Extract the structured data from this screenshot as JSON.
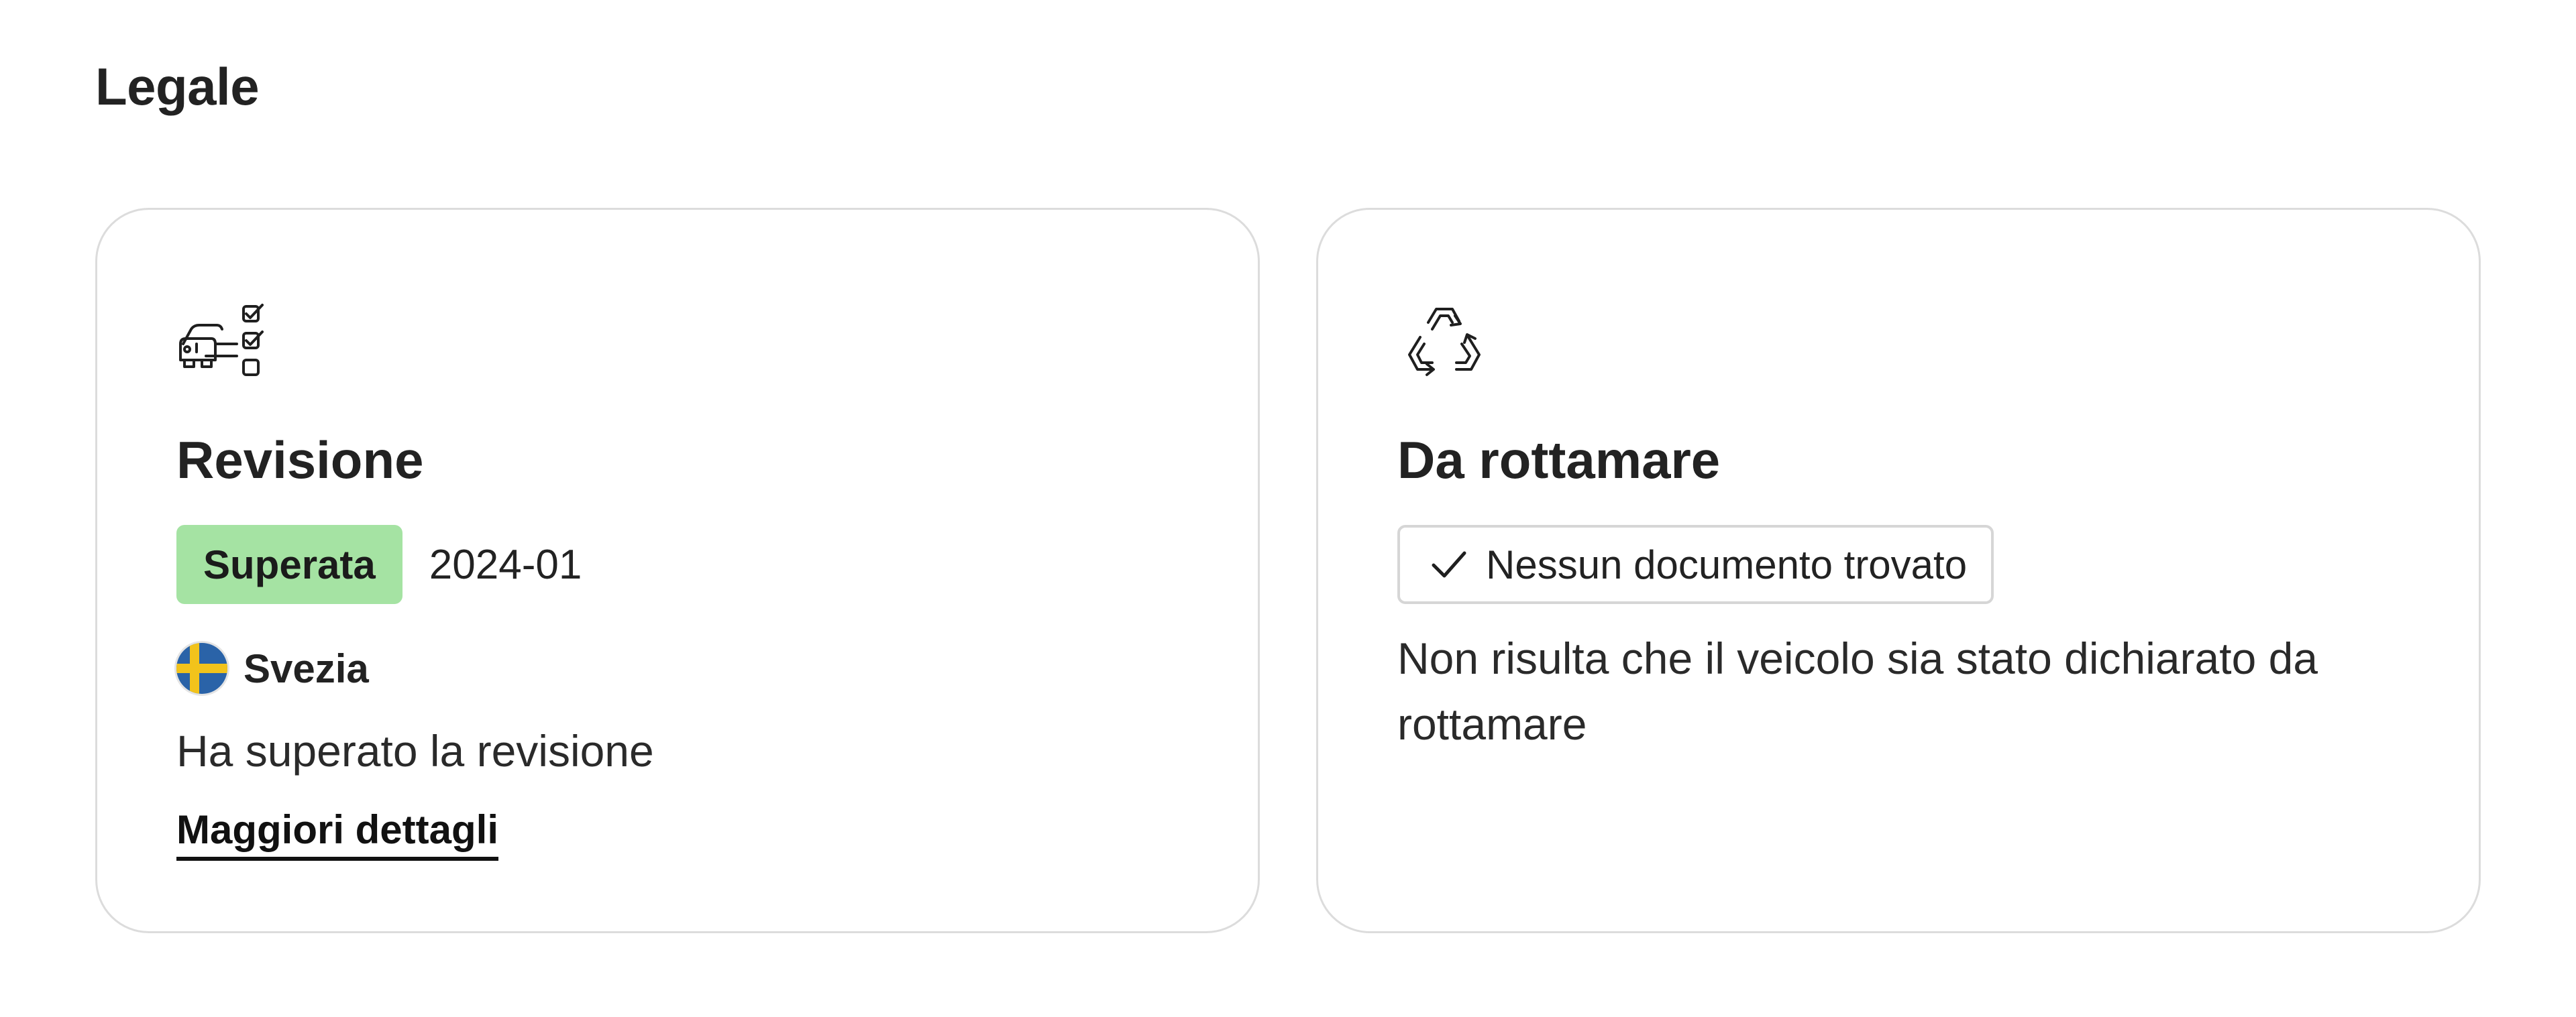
{
  "section": {
    "title": "Legale"
  },
  "inspection": {
    "icon": "inspection-checklist-icon",
    "title": "Revisione",
    "status_label": "Superata",
    "status_color": "#a5e3a3",
    "date": "2024-01",
    "country_flag": "sweden-flag-icon",
    "country": "Svezia",
    "description": "Ha superato la revisione",
    "details_link": "Maggiori dettagli"
  },
  "scrap": {
    "icon": "recycle-icon",
    "title": "Da rottamare",
    "chip_icon": "check-icon",
    "chip_label": "Nessun documento trovato",
    "description": "Non risulta che il veicolo sia stato dichiarato da rottamare"
  }
}
